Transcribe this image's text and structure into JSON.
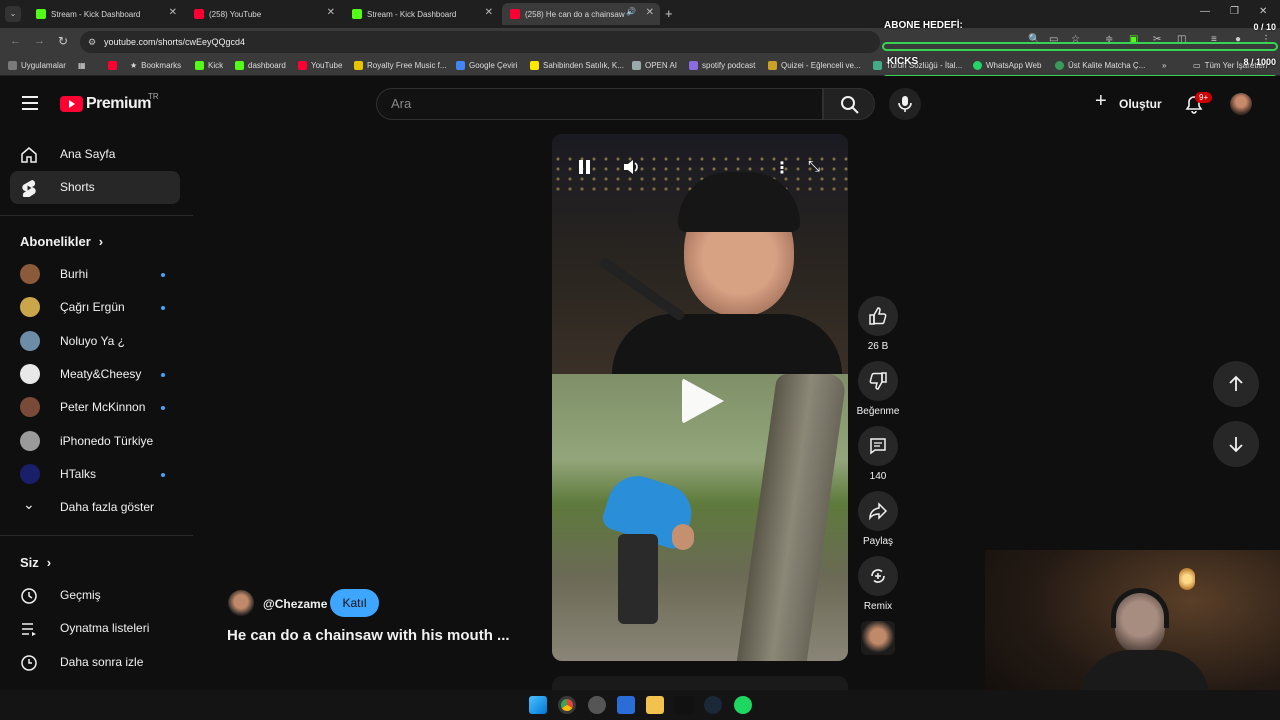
{
  "browser": {
    "tabs": [
      {
        "title": "Stream - Kick Dashboard",
        "active": false
      },
      {
        "title": "(258) YouTube",
        "active": false
      },
      {
        "title": "Stream - Kick Dashboard",
        "active": false
      },
      {
        "title": "(258) He can do a chainsaw",
        "active": true
      }
    ],
    "url": "youtube.com/shorts/cwEeyQQgcd4",
    "bookmarks": [
      "Uygulamalar",
      "Bookmarks",
      "Kick",
      "dashboard",
      "YouTube",
      "Royalty Free Music f...",
      "Google Çeviri",
      "Sahibinden Satılık, K...",
      "OPEN AI",
      "spotify podcast",
      "Quizei - Eğlenceli ve...",
      "Turun Sözlüğü - İtal...",
      "WhatsApp Web",
      "Üst Kalite Matcha Ç...",
      "»",
      "Tüm Yer İşaretleri"
    ]
  },
  "overlay": {
    "sub_goal_label": "ABONE HEDEFİ:",
    "sub_goal_value": "0 / 10",
    "kicks_label": "KICKS",
    "kicks_value": "8 / 1000",
    "kicks_fraction": 0.008
  },
  "youtube": {
    "logo": "Premium",
    "region": "TR",
    "search_placeholder": "Ara",
    "create_label": "Oluştur",
    "notif_count": "9+",
    "nav": [
      {
        "label": "Ana Sayfa",
        "icon": "home-icon"
      },
      {
        "label": "Shorts",
        "icon": "shorts-icon",
        "active": true
      }
    ],
    "subscriptions_title": "Abonelikler",
    "subscriptions": [
      {
        "name": "Burhi",
        "new": true
      },
      {
        "name": "Çağrı Ergün",
        "new": true
      },
      {
        "name": "Noluyo Ya ¿",
        "new": false
      },
      {
        "name": "Meaty&Cheesy",
        "new": true
      },
      {
        "name": "Peter McKinnon",
        "new": true
      },
      {
        "name": "iPhonedo Türkiye",
        "new": false
      },
      {
        "name": "HTalks",
        "new": true
      }
    ],
    "show_more": "Daha fazla göster",
    "you_title": "Siz",
    "you_items": [
      {
        "label": "Geçmiş",
        "icon": "history-icon"
      },
      {
        "label": "Oynatma listeleri",
        "icon": "playlist-icon"
      },
      {
        "label": "Daha sonra izle",
        "icon": "watch-later-icon"
      }
    ],
    "short": {
      "channel": "@Chezame",
      "join_label": "Katıl",
      "title": "He can do a chainsaw with his mouth ...",
      "likes": "26 B",
      "dislike_label": "Beğenme",
      "comments": "140",
      "share_label": "Paylaş",
      "remix_label": "Remix"
    }
  }
}
